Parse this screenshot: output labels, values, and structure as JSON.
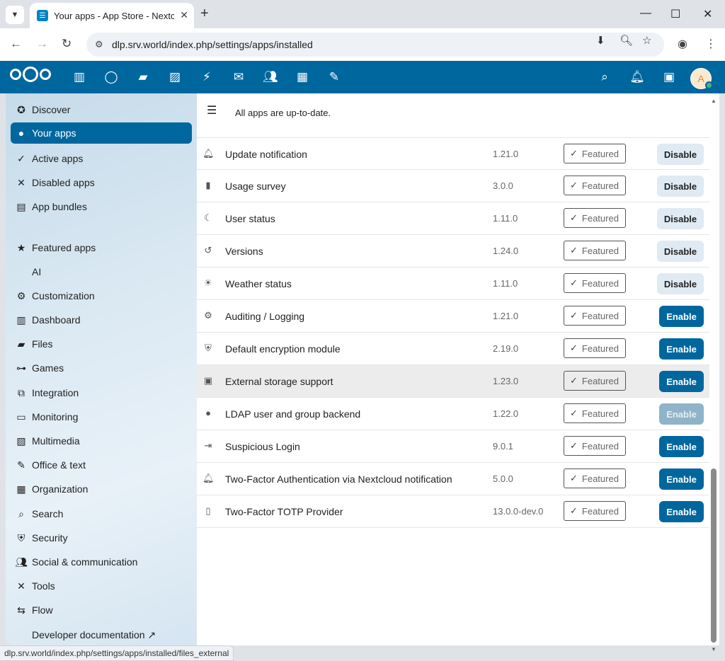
{
  "browser": {
    "tab_title": "Your apps - App Store - Nextcloud",
    "url": "dlp.srv.world/index.php/settings/apps/installed",
    "status_url": "dlp.srv.world/index.php/settings/apps/installed/files_external"
  },
  "header": {
    "avatar_letter": "A"
  },
  "sidebar": {
    "items": [
      {
        "label": "Discover",
        "icon": "star-circle-icon"
      },
      {
        "label": "Your apps",
        "icon": "account-icon",
        "active": true
      },
      {
        "label": "Active apps",
        "icon": "check-icon"
      },
      {
        "label": "Disabled apps",
        "icon": "close-icon"
      },
      {
        "label": "App bundles",
        "icon": "archive-icon"
      },
      {
        "label": "Featured apps",
        "icon": "star-icon"
      },
      {
        "label": "AI",
        "icon": ""
      },
      {
        "label": "Customization",
        "icon": "cog-icon"
      },
      {
        "label": "Dashboard",
        "icon": "dashboard-icon"
      },
      {
        "label": "Files",
        "icon": "folder-icon"
      },
      {
        "label": "Games",
        "icon": "gamepad-icon"
      },
      {
        "label": "Integration",
        "icon": "integration-icon"
      },
      {
        "label": "Monitoring",
        "icon": "monitor-icon"
      },
      {
        "label": "Multimedia",
        "icon": "multimedia-icon"
      },
      {
        "label": "Office & text",
        "icon": "office-icon"
      },
      {
        "label": "Organization",
        "icon": "organization-icon"
      },
      {
        "label": "Search",
        "icon": "search-icon"
      },
      {
        "label": "Security",
        "icon": "shield-icon"
      },
      {
        "label": "Social & communication",
        "icon": "people-icon"
      },
      {
        "label": "Tools",
        "icon": "tools-icon"
      },
      {
        "label": "Flow",
        "icon": "flow-icon"
      },
      {
        "label": "Developer documentation ↗",
        "icon": ""
      }
    ]
  },
  "main": {
    "status": "All apps are up-to-date.",
    "featured_label": "Featured",
    "apps": [
      {
        "name": "Update notification",
        "version": "1.21.0",
        "action": "Disable",
        "icon": "bell-icon"
      },
      {
        "name": "Usage survey",
        "version": "3.0.0",
        "action": "Disable",
        "icon": "chart-icon"
      },
      {
        "name": "User status",
        "version": "1.11.0",
        "action": "Disable",
        "icon": "moon-icon"
      },
      {
        "name": "Versions",
        "version": "1.24.0",
        "action": "Disable",
        "icon": "history-icon"
      },
      {
        "name": "Weather status",
        "version": "1.11.0",
        "action": "Disable",
        "icon": "sun-icon"
      },
      {
        "name": "Auditing / Logging",
        "version": "1.21.0",
        "action": "Enable",
        "icon": "cog-icon"
      },
      {
        "name": "Default encryption module",
        "version": "2.19.0",
        "action": "Enable",
        "icon": "shield-icon"
      },
      {
        "name": "External storage support",
        "version": "1.23.0",
        "action": "Enable",
        "icon": "folder-image-icon",
        "hover": true
      },
      {
        "name": "LDAP user and group backend",
        "version": "1.22.0",
        "action": "Enable",
        "icon": "user-icon",
        "disabled": true
      },
      {
        "name": "Suspicious Login",
        "version": "9.0.1",
        "action": "Enable",
        "icon": "login-icon"
      },
      {
        "name": "Two-Factor Authentication via Nextcloud notification",
        "version": "5.0.0",
        "action": "Enable",
        "icon": "bell-check-icon"
      },
      {
        "name": "Two-Factor TOTP Provider",
        "version": "13.0.0-dev.0",
        "action": "Enable",
        "icon": "phone-lock-icon"
      }
    ]
  }
}
